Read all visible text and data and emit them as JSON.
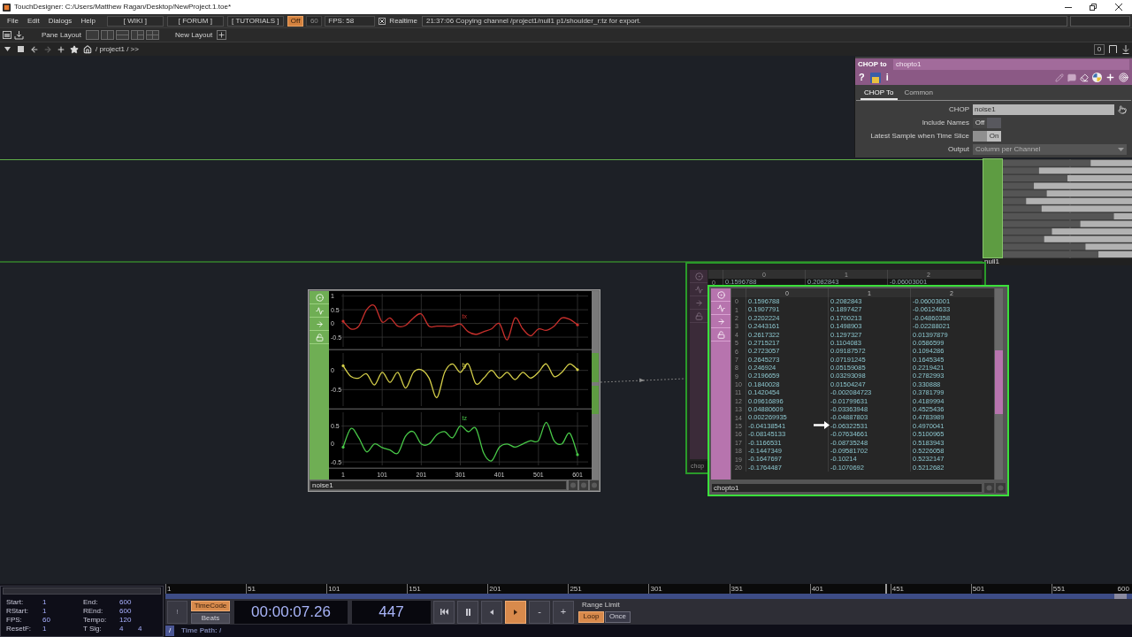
{
  "window": {
    "title": "TouchDesigner: C:/Users/Matthew Ragan/Desktop/NewProject.1.toe*"
  },
  "menu_bar": {
    "menus": [
      "File",
      "Edit",
      "Dialogs",
      "Help"
    ],
    "links": [
      "[ WIKI ]",
      "[ FORUM ]",
      "[ TUTORIALS ]"
    ],
    "power": {
      "label": "Off",
      "active": true
    },
    "fps_field": {
      "value": "60",
      "disabled": true
    },
    "fps_reading": "FPS: 58",
    "realtime": {
      "label": "Realtime",
      "checked": true
    },
    "status": "21:37:06 Copying channel /project1/null1 p1/shoulder_r:tz for export."
  },
  "layout_bar": {
    "pane_layout": "Pane Layout",
    "new_layout": "New Layout"
  },
  "path_bar": {
    "path": "/ project1 / >>",
    "pane_index": "0"
  },
  "parameters": {
    "op_type": "CHOP to",
    "op_name": "chopto1",
    "header_tools": [
      {
        "kind": "text",
        "label": "?"
      },
      {
        "kind": "document"
      },
      {
        "kind": "text",
        "label": "i"
      }
    ],
    "tabs": [
      {
        "label": "CHOP To",
        "selected": true
      },
      {
        "label": "Common",
        "selected": false
      }
    ],
    "params": [
      {
        "kind": "field",
        "label": "CHOP",
        "value": "noise1"
      },
      {
        "kind": "toggle",
        "label": "Include Names",
        "value": "Off",
        "on": false
      },
      {
        "kind": "toggle",
        "label": "Latest Sample when Time Slice",
        "value": "On",
        "on": true
      },
      {
        "kind": "menu",
        "label": "Output",
        "value": "Column per Channel"
      }
    ]
  },
  "network": {
    "null1": {
      "name": "null1"
    },
    "noise1": {
      "name": "noise1",
      "selected": false,
      "panels": [
        {
          "chart_data": {
            "type": "line",
            "x": [
              1,
              21,
              41,
              61,
              81,
              101,
              121,
              141,
              161,
              181,
              201,
              221,
              241,
              261,
              281,
              301,
              321,
              341,
              361,
              381,
              401,
              421,
              441,
              461,
              481,
              501,
              521,
              541,
              561,
              581,
              601
            ],
            "series": [
              {
                "name": "tx",
                "color": "#c8302c",
                "values": [
                  0.08,
                  -0.2,
                  -0.1,
                  0.5,
                  0.65,
                  0.05,
                  0.2,
                  -0.1,
                  -0.07,
                  0.2,
                  0.35,
                  -0.1,
                  -0.1,
                  -0.1,
                  -0.1,
                  -0.02,
                  -0.3,
                  -0.4,
                  -0.3,
                  -0.2,
                  0,
                  -0.6,
                  0.2,
                  -0.2,
                  -0.45,
                  -0.2,
                  -0.25,
                  -0.1,
                  0.2,
                  0.15,
                  -0.05
                ]
              }
            ],
            "xlim": [
              1,
              601
            ],
            "ylim": [
              -0.95,
              1.15
            ],
            "yticks": [
              1,
              0.5,
              0,
              -0.5
            ],
            "grid": true
          }
        },
        {
          "chart_data": {
            "type": "line",
            "x": [
              1,
              21,
              41,
              61,
              81,
              101,
              121,
              141,
              161,
              181,
              201,
              221,
              241,
              261,
              281,
              301,
              321,
              341,
              361,
              381,
              401,
              421,
              441,
              461,
              481,
              501,
              521,
              541,
              561,
              581,
              601
            ],
            "series": [
              {
                "name": "ty",
                "color": "#d6d04a",
                "values": [
                  0.12,
                  -0.16,
                  -0.2,
                  -0.09,
                  -0.38,
                  -0.05,
                  -0.31,
                  -0.05,
                  -0.46,
                  -0.05,
                  0.02,
                  -0.2,
                  -0.71,
                  -0.05,
                  0.17,
                  -0.05,
                  0.17,
                  -0.35,
                  -0.2,
                  0,
                  -0.2,
                  -0.05,
                  -0.24,
                  -0.05,
                  -0.2,
                  -0.05,
                  0.17,
                  -0.16,
                  -0.05,
                  0.17,
                  0.02
                ]
              }
            ],
            "xlim": [
              1,
              601
            ],
            "ylim": [
              -1,
              0.5
            ],
            "yticks": [
              0,
              -0.5
            ],
            "grid": true
          }
        },
        {
          "chart_data": {
            "type": "line",
            "x": [
              1,
              21,
              41,
              61,
              81,
              101,
              121,
              141,
              161,
              181,
              201,
              221,
              241,
              261,
              281,
              301,
              321,
              341,
              361,
              381,
              401,
              421,
              441,
              461,
              481,
              501,
              521,
              541,
              561,
              581,
              601
            ],
            "series": [
              {
                "name": "tz",
                "color": "#48c848",
                "values": [
                  -0.09,
                  0.43,
                  0.17,
                  -0.22,
                  0,
                  -0.1,
                  -0.17,
                  -0.26,
                  0.22,
                  0.34,
                  0,
                  0,
                  0.26,
                  0.34,
                  0.17,
                  0.5,
                  0.34,
                  0.43,
                  -0.26,
                  -0.47,
                  -0.09,
                  0,
                  -0.09,
                  0,
                  0.09,
                  0.09,
                  0.6,
                  0.09,
                  0,
                  0.3,
                  -0.3
                ]
              }
            ],
            "xlim": [
              1,
              601
            ],
            "ylim": [
              -0.67,
              0.93
            ],
            "xticks": [
              1,
              101,
              201,
              301,
              401,
              501,
              601
            ],
            "yticks": [
              0.5,
              0,
              -0.5
            ],
            "grid": true
          }
        }
      ]
    },
    "ghost": {
      "name": "chop",
      "columns": [
        "0",
        "1",
        "2"
      ],
      "rows": [
        {
          "index": "0",
          "cells": [
            "0.1596788",
            "0.2082843",
            "-0.06003001"
          ]
        }
      ]
    },
    "chopto1": {
      "name": "chopto1",
      "selected": true,
      "columns": [
        "0",
        "1",
        "2"
      ],
      "rows": [
        {
          "index": "0",
          "cells": [
            "0.1596788",
            "0.2082843",
            "-0.06003001"
          ]
        },
        {
          "index": "1",
          "cells": [
            "0.1907791",
            "0.1897427",
            "-0.06124633"
          ]
        },
        {
          "index": "2",
          "cells": [
            "0.2202224",
            "0.1700213",
            "-0.04860358"
          ]
        },
        {
          "index": "3",
          "cells": [
            "0.2443161",
            "0.1498903",
            "-0.02288021"
          ]
        },
        {
          "index": "4",
          "cells": [
            "0.2617322",
            "0.1297327",
            "0.01397879"
          ]
        },
        {
          "index": "5",
          "cells": [
            "0.2715217",
            "0.1104083",
            "0.0586599"
          ]
        },
        {
          "index": "6",
          "cells": [
            "0.2723057",
            "0.09187572",
            "0.1094286"
          ]
        },
        {
          "index": "7",
          "cells": [
            "0.2645273",
            "0.07191245",
            "0.1645345"
          ]
        },
        {
          "index": "8",
          "cells": [
            "0.246924",
            "0.05159085",
            "0.2219421"
          ]
        },
        {
          "index": "9",
          "cells": [
            "0.2196659",
            "0.03293098",
            "0.2782993"
          ]
        },
        {
          "index": "10",
          "cells": [
            "0.1840028",
            "0.01504247",
            "0.330888"
          ]
        },
        {
          "index": "11",
          "cells": [
            "0.1420454",
            "-0.002084723",
            "0.3781799"
          ]
        },
        {
          "index": "12",
          "cells": [
            "0.09616896",
            "-0.01799631",
            "0.4189994"
          ]
        },
        {
          "index": "13",
          "cells": [
            "0.04880609",
            "-0.03363948",
            "0.4525436"
          ]
        },
        {
          "index": "14",
          "cells": [
            "0.002269935",
            "-0.04887803",
            "0.4783989"
          ]
        },
        {
          "index": "15",
          "cells": [
            "-0.04138541",
            "-0.06322531",
            "0.4970041"
          ]
        },
        {
          "index": "16",
          "cells": [
            "-0.08145133",
            "-0.07634661",
            "0.5100965"
          ]
        },
        {
          "index": "17",
          "cells": [
            "-0.1166531",
            "-0.08735248",
            "0.5183943"
          ]
        },
        {
          "index": "18",
          "cells": [
            "-0.1447349",
            "-0.09581702",
            "0.5226058"
          ]
        },
        {
          "index": "19",
          "cells": [
            "-0.1647697",
            "-0.10214",
            "0.5232147"
          ]
        },
        {
          "index": "20",
          "cells": [
            "-0.1764487",
            "-0.1070692",
            "0.5212682"
          ]
        }
      ]
    }
  },
  "timeline": {
    "info": [
      {
        "label": "Start:",
        "values": [
          "1"
        ]
      },
      {
        "label": "End:",
        "values": [
          "600"
        ]
      },
      {
        "label": "RStart:",
        "values": [
          "1"
        ]
      },
      {
        "label": "REnd:",
        "values": [
          "600"
        ]
      },
      {
        "label": "FPS:",
        "values": [
          "60"
        ]
      },
      {
        "label": "Tempo:",
        "values": [
          "120"
        ]
      },
      {
        "label": "ResetF:",
        "values": [
          "1"
        ]
      },
      {
        "label": "T Sig:",
        "values": [
          "4",
          "4"
        ]
      }
    ],
    "ruler": {
      "ticks": [
        "1",
        "51",
        "101",
        "151",
        "201",
        "251",
        "301",
        "351",
        "401",
        "451",
        "501",
        "551",
        "600"
      ],
      "level": 0.745
    },
    "reset_button": "!",
    "time_modes": [
      {
        "label": "TimeCode",
        "selected": true
      },
      {
        "label": "Beats",
        "selected": false
      }
    ],
    "timecode": "00:00:07.26",
    "frame": "447",
    "transport": [
      {
        "kind": "to-start",
        "active": false
      },
      {
        "kind": "pause",
        "active": false
      },
      {
        "kind": "step-back",
        "active": false
      },
      {
        "kind": "play",
        "active": true
      },
      {
        "kind": "text",
        "label": "-",
        "active": false
      },
      {
        "kind": "text",
        "label": "+",
        "active": false
      }
    ],
    "range_limit": {
      "label": "Range Limit",
      "options": [
        {
          "label": "Loop",
          "selected": true
        },
        {
          "label": "Once",
          "selected": false
        }
      ]
    },
    "time_path": {
      "root": "/",
      "label": "Time Path: /"
    }
  }
}
